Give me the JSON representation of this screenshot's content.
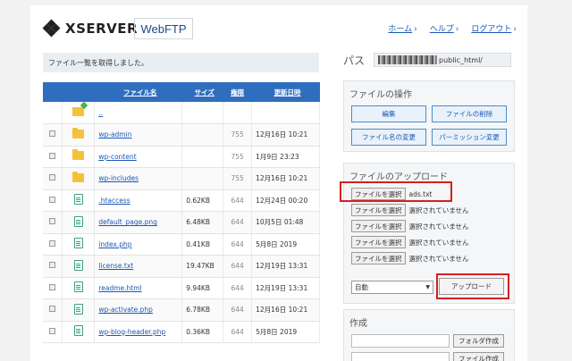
{
  "header": {
    "brand": "XSERVER",
    "product": "WebFTP",
    "nav": [
      "ホーム",
      "ヘルプ",
      "ログアウト"
    ]
  },
  "message": "ファイル一覧を取得しました。",
  "table": {
    "columns": [
      "ファイル名",
      "サイズ",
      "権限",
      "更新日時"
    ],
    "rows": [
      {
        "name": "..",
        "size": "",
        "perm": "",
        "date": "",
        "type": "up"
      },
      {
        "name": "wp-admin",
        "size": "",
        "perm": "755",
        "date": "12月16日 10:21",
        "type": "folder"
      },
      {
        "name": "wp-content",
        "size": "",
        "perm": "755",
        "date": "1月9日 23:23",
        "type": "folder"
      },
      {
        "name": "wp-includes",
        "size": "",
        "perm": "755",
        "date": "12月16日 10:21",
        "type": "folder"
      },
      {
        "name": ".htaccess",
        "size": "0.62KB",
        "perm": "644",
        "date": "12月24日 00:20",
        "type": "file"
      },
      {
        "name": "default_page.png",
        "size": "6.48KB",
        "perm": "644",
        "date": "10月5日 01:48",
        "type": "file"
      },
      {
        "name": "index.php",
        "size": "0.41KB",
        "perm": "644",
        "date": "5月8日 2019",
        "type": "file"
      },
      {
        "name": "license.txt",
        "size": "19.47KB",
        "perm": "644",
        "date": "12月19日 13:31",
        "type": "file"
      },
      {
        "name": "readme.html",
        "size": "9.94KB",
        "perm": "644",
        "date": "12月19日 13:31",
        "type": "file"
      },
      {
        "name": "wp-activate.php",
        "size": "6.78KB",
        "perm": "644",
        "date": "12月16日 10:21",
        "type": "file"
      },
      {
        "name": "wp-blog-header.php",
        "size": "0.36KB",
        "perm": "644",
        "date": "5月8日 2019",
        "type": "file"
      }
    ]
  },
  "path": {
    "label": "パス",
    "value": "public_html/"
  },
  "file_ops": {
    "title": "ファイルの操作",
    "buttons": [
      "編集",
      "ファイルの削除",
      "ファイル名の変更",
      "パーミッション変更"
    ]
  },
  "upload": {
    "title": "ファイルのアップロード",
    "choose_label": "ファイルを選択",
    "files": [
      "ads.txt",
      "選択されていません",
      "選択されていません",
      "選択されていません",
      "選択されていません"
    ],
    "mode": "自動",
    "submit": "アップロード"
  },
  "create": {
    "title": "作成",
    "buttons": [
      "フォルダ作成",
      "ファイル作成"
    ]
  }
}
